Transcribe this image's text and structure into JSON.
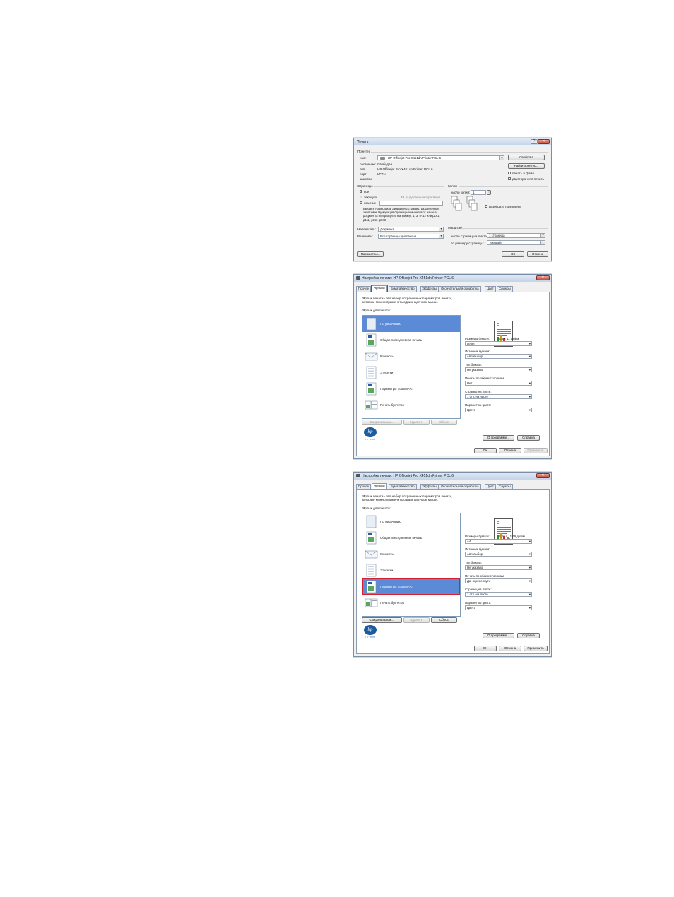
{
  "print_dialog": {
    "title": "Печать",
    "window_buttons": [
      "?",
      "×"
    ],
    "printer_group": "Принтер",
    "name_label": "имя:",
    "name_value": "HP Officejet Pro X451dn Printer PCL 6",
    "status_label": "состояние:",
    "status_value": "Свободен",
    "type_label": "тип:",
    "type_value": "HP Officejet Pro X451dn Printer PCL 6",
    "port_label": "порт:",
    "port_value": "LPT1:",
    "notes_label": "заметки:",
    "properties_button": "Свойства",
    "find_printer_button": "Найти принтер...",
    "print_to_file": "печать в файл",
    "duplex_manual": "двусторонняя печать",
    "pages_group": "Страницы",
    "all": "все",
    "current": "текущая",
    "selection": "выделенный фрагмент",
    "pages": "номера:",
    "pages_hint": "Введите номера или диапазоны страниц, разделенные запятыми. Нумерация страниц начинается от начала документа или раздела. Например: 1, 3, 5–12 или p1s1, p1s2, p1s3–p8s3",
    "copies_group": "Копии",
    "copies_label": "число копий:",
    "copies_value": "1",
    "collate": "разобрать по копиям",
    "print_what_label": "Напечатать:",
    "print_what_value": "Документ",
    "include_label": "Включить:",
    "include_value": "Все страницы диапазона",
    "zoom_group": "Масштаб",
    "pages_per_sheet_label": "число страниц на листе:",
    "pages_per_sheet_value": "1 страница",
    "scale_label": "по размеру страницы:",
    "scale_value": "Текущий",
    "options_button": "Параметры...",
    "ok_button": "ОК",
    "cancel_button": "Отмена"
  },
  "prefs_1": {
    "title": "Настройка печати: HP Officejet Pro X451dn Printer PCL 6",
    "tabs": [
      "Прочее",
      "Ярлыки",
      "Бумага/качество",
      "Эффекты",
      "Окончательная обработка",
      "Цвет",
      "Службы"
    ],
    "description": "Ярлык печати - это набор сохраненных параметров печати, которые можно применить одним щелчком мыши.",
    "list_label": "Ярлык для печати:",
    "items": [
      "По умолчанию",
      "Общая повседневная печать",
      "Конверты",
      "Этикетки",
      "Параметры EcoSMART",
      "Печать буклетов"
    ],
    "save_as": "Сохранить как...",
    "delete": "Удалить",
    "reset": "Сброс",
    "paper_size_label": "Размеры бумаги:",
    "paper_size_dims": "8,5 × 11 дюйм.",
    "paper_size_value": "Letter",
    "source_label": "Источник бумаги:",
    "source_value": "Автовыбор",
    "type_label": "Тип бумаги:",
    "type_value": "Не указано",
    "duplex_label": "Печать по обеим сторонам:",
    "duplex_value": "Нет",
    "pps_label": "Страниц на листе:",
    "pps_value": "1 стр. на листе",
    "color_label": "Параметры цвета:",
    "color_value": "Цвета",
    "about_button": "О программе...",
    "help_button": "Справка",
    "ok_button": "OK",
    "cancel_button": "Отмена",
    "apply_button": "Применить",
    "logo_text": "invent"
  },
  "prefs_2": {
    "title": "Настройка печати: HP Officejet Pro X451dn Printer PCL 6",
    "tabs": [
      "Прочее",
      "Ярлыки",
      "Бумага/качество",
      "Эффекты",
      "Окончательная обработка",
      "Цвет",
      "Службы"
    ],
    "description": "Ярлык печати - это набор сохраненных параметров печати, которые можно применить одним щелчком мыши.",
    "list_label": "Ярлык для печати:",
    "items": [
      "По умолчанию",
      "Общая повседневная печать",
      "Конверты",
      "Этикетки",
      "Параметры EcoSMART",
      "Печать буклетов"
    ],
    "save_as": "Сохранить как...",
    "delete": "Удалить",
    "reset": "Сброс",
    "paper_size_label": "Размеры бумаги:",
    "paper_size_dims": "8,27 × 11,69 дюйм.",
    "paper_size_value": "A4",
    "source_label": "Источник бумаги:",
    "source_value": "Автовыбор",
    "type_label": "Тип бумаги:",
    "type_value": "Не указано",
    "duplex_label": "Печать по обеим сторонам:",
    "duplex_value": "Да, перевернуть",
    "pps_label": "Страниц на листе:",
    "pps_value": "1 стр. на листе",
    "color_label": "Параметры цвета:",
    "color_value": "Цвета",
    "about_button": "О программе...",
    "help_button": "Справка",
    "ok_button": "OK",
    "cancel_button": "Отмена",
    "apply_button": "Применить",
    "logo_text": "invent"
  },
  "colors": {
    "selection": "#5b8ad6",
    "highlight": "#d6202f",
    "hp_blue": "#1d5a9e"
  }
}
